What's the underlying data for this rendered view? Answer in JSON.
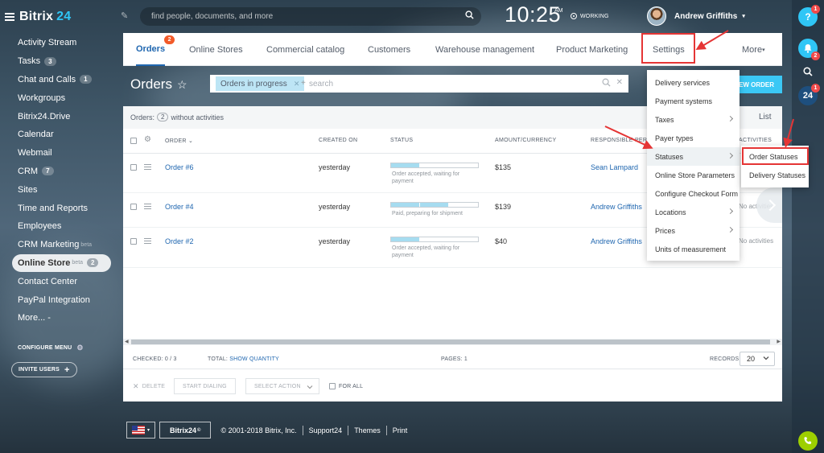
{
  "app": {
    "logo_text": "Bitrix",
    "logo_number": "24"
  },
  "sidebar": {
    "items": [
      {
        "label": "Activity Stream",
        "count": ""
      },
      {
        "label": "Tasks",
        "count": "3"
      },
      {
        "label": "Chat and Calls",
        "count": "1"
      },
      {
        "label": "Workgroups",
        "count": ""
      },
      {
        "label": "Bitrix24.Drive",
        "count": ""
      },
      {
        "label": "Calendar",
        "count": ""
      },
      {
        "label": "Webmail",
        "count": ""
      },
      {
        "label": "CRM",
        "count": "7"
      },
      {
        "label": "Sites",
        "count": ""
      },
      {
        "label": "Time and Reports",
        "count": ""
      },
      {
        "label": "Employees",
        "count": ""
      },
      {
        "label": "CRM Marketing",
        "count": "",
        "sup": "beta"
      },
      {
        "label": "Online Store",
        "count": "2",
        "sup": "beta",
        "active": true
      },
      {
        "label": "Contact Center",
        "count": ""
      },
      {
        "label": "PayPal Integration",
        "count": ""
      },
      {
        "label": "More... -",
        "count": ""
      }
    ],
    "configure_menu": "CONFIGURE MENU",
    "invite_users": "INVITE USERS"
  },
  "header": {
    "search_placeholder": "find people, documents, and more",
    "time": "10:25",
    "ampm": "AM",
    "working": "WORKING",
    "user_name": "Andrew Griffiths"
  },
  "rightbar": {
    "help": "?",
    "notify_badge": "2",
    "b24_label": "24",
    "b24_badge": "1"
  },
  "tabs": [
    {
      "label": "Orders",
      "badge": "2",
      "active": true
    },
    {
      "label": "Online Stores"
    },
    {
      "label": "Commercial catalog"
    },
    {
      "label": "Customers"
    },
    {
      "label": "Warehouse management"
    },
    {
      "label": "Product Marketing"
    },
    {
      "label": "Settings"
    },
    {
      "label": "More"
    }
  ],
  "page": {
    "title": "Orders",
    "filter_chip": "Orders in progress",
    "filter_placeholder": "search",
    "new_order": "NEW ORDER"
  },
  "grid": {
    "orders_label": "Orders:",
    "orders_count": "2",
    "orders_suffix": "without activities",
    "view_list": "List",
    "columns": [
      "ORDER",
      "CREATED ON",
      "STATUS",
      "AMOUNT/CURRENCY",
      "RESPONSIBLE PERSON",
      "ACTIVITIES"
    ],
    "rows": [
      {
        "order": "Order #6",
        "created": "yesterday",
        "status": "Order accepted, waiting for payment",
        "progress_segments": 1,
        "amount": "$135",
        "responsible": "Sean Lampard",
        "activities": ""
      },
      {
        "order": "Order #4",
        "created": "yesterday",
        "status": "Paid, preparing for shipment",
        "progress_segments": 2,
        "amount": "$139",
        "responsible": "Andrew Griffiths",
        "activities": "No activities"
      },
      {
        "order": "Order #2",
        "created": "yesterday",
        "status": "Order accepted, waiting for payment",
        "progress_segments": 1,
        "amount": "$40",
        "responsible": "Andrew Griffiths",
        "activities": "No activities"
      }
    ],
    "progress_total_segments": 3,
    "checked_label": "CHECKED: 0 / 3",
    "total_label": "TOTAL:",
    "show_quantity": "SHOW QUANTITY",
    "pages_label": "PAGES: 1",
    "records_label": "RECORDS:",
    "records_value": "20",
    "delete": "DELETE",
    "start_dialing": "START DIALING",
    "select_action": "SELECT ACTION",
    "for_all": "FOR ALL"
  },
  "settings_menu": {
    "items": [
      {
        "label": "Delivery services",
        "submenu": false
      },
      {
        "label": "Payment systems",
        "submenu": false
      },
      {
        "label": "Taxes",
        "submenu": true
      },
      {
        "label": "Payer types",
        "submenu": false
      },
      {
        "label": "Statuses",
        "submenu": true,
        "highlighted": true
      },
      {
        "label": "Online Store Parameters",
        "submenu": false
      },
      {
        "label": "Configure Checkout Form",
        "submenu": false
      },
      {
        "label": "Locations",
        "submenu": true
      },
      {
        "label": "Prices",
        "submenu": true
      },
      {
        "label": "Units of measurement",
        "submenu": false
      }
    ],
    "statuses_submenu": [
      "Order Statuses",
      "Delivery Statuses"
    ]
  },
  "footer": {
    "brand": "Bitrix24",
    "copyright": "© 2001-2018 Bitrix, Inc.",
    "links": [
      "Support24",
      "Themes",
      "Print"
    ]
  },
  "colors": {
    "accent": "#2067b0",
    "highlight_box": "#e53535",
    "new_order_bg": "#3bc8f5",
    "progress_fill": "#a6dcf0"
  }
}
